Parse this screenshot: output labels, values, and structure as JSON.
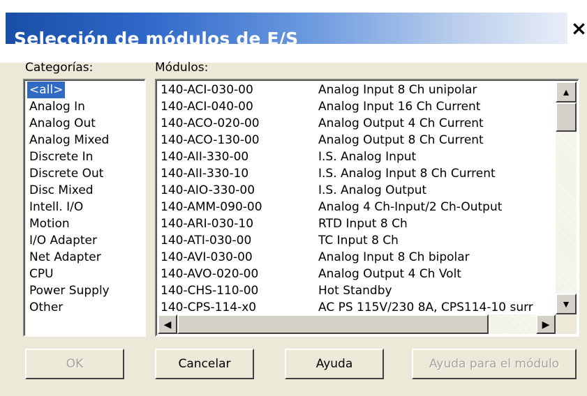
{
  "window": {
    "title": "Selección de módulos de E/S",
    "close_label": "×"
  },
  "categories_label": "Categorías:",
  "modules_label": "Módulos:",
  "categories": [
    {
      "label": "<all>",
      "selected": true
    },
    {
      "label": "Analog In"
    },
    {
      "label": "Analog Out"
    },
    {
      "label": "Analog Mixed"
    },
    {
      "label": "Discrete In"
    },
    {
      "label": "Discrete Out"
    },
    {
      "label": "Disc Mixed"
    },
    {
      "label": "Intell. I/O"
    },
    {
      "label": "Motion"
    },
    {
      "label": "I/O Adapter"
    },
    {
      "label": "Net Adapter"
    },
    {
      "label": "CPU"
    },
    {
      "label": "Power Supply"
    },
    {
      "label": "Other"
    }
  ],
  "modules": [
    {
      "code": "140-ACI-030-00",
      "desc": "Analog Input  8 Ch unipolar"
    },
    {
      "code": "140-ACI-040-00",
      "desc": "Analog Input 16 Ch Current"
    },
    {
      "code": "140-ACO-020-00",
      "desc": "Analog Output 4 Ch Current"
    },
    {
      "code": "140-ACO-130-00",
      "desc": "Analog Output 8 Ch Current"
    },
    {
      "code": "140-AII-330-00",
      "desc": "I.S. Analog Input"
    },
    {
      "code": "140-AII-330-10",
      "desc": "I.S. Analog Input 8 Ch Current"
    },
    {
      "code": "140-AIO-330-00",
      "desc": "I.S. Analog Output"
    },
    {
      "code": "140-AMM-090-00",
      "desc": "Analog 4 Ch-Input/2 Ch-Output"
    },
    {
      "code": "140-ARI-030-10",
      "desc": "RTD Input 8 Ch"
    },
    {
      "code": "140-ATI-030-00",
      "desc": "TC Input 8 Ch"
    },
    {
      "code": "140-AVI-030-00",
      "desc": "Analog Input 8 Ch bipolar"
    },
    {
      "code": "140-AVO-020-00",
      "desc": "Analog Output 4 Ch Volt"
    },
    {
      "code": "140-CHS-110-00",
      "desc": "Hot Standby"
    },
    {
      "code": "140-CPS-114-x0",
      "desc": "AC PS 115V/230 8A, CPS114-10 surr"
    }
  ],
  "scroll": {
    "up": "▲",
    "down": "▼",
    "left": "◀",
    "right": "▶"
  },
  "buttons": {
    "ok": "OK",
    "cancel": "Cancelar",
    "help": "Ayuda",
    "module_help": "Ayuda para el módulo"
  }
}
